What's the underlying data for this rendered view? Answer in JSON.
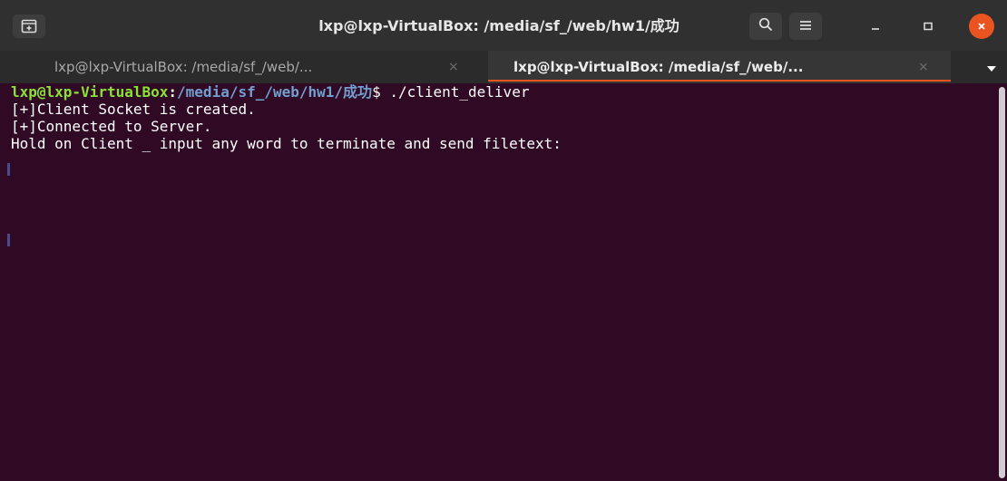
{
  "window": {
    "title": "lxp@lxp-VirtualBox: /media/sf_/web/hw1/成功"
  },
  "tabs": [
    {
      "label": "lxp@lxp-VirtualBox: /media/sf_/web/...",
      "close": "×",
      "active": false
    },
    {
      "label": "lxp@lxp-VirtualBox: /media/sf_/web/...",
      "close": "×",
      "active": true
    }
  ],
  "terminal": {
    "prompt_user": "lxp@lxp-VirtualBox",
    "prompt_colon": ":",
    "prompt_path": "/media/sf_/web/hw1/成功",
    "prompt_dollar": "$ ",
    "command": "./client_deliver",
    "output": [
      "[+]Client Socket is created.",
      "[+]Connected to Server.",
      "Hold on Client _ input any word to terminate and send filetext:"
    ]
  },
  "icons": {
    "new_tab": "new-tab-icon",
    "search": "search-icon",
    "menu": "hamburger-menu-icon",
    "minimize": "minimize-icon",
    "maximize": "maximize-icon",
    "close": "close-icon",
    "dropdown": "chevron-down-icon"
  },
  "colors": {
    "terminal_bg": "#300a24",
    "prompt_user": "#8ae234",
    "prompt_path": "#729fcf",
    "accent": "#e95420"
  }
}
